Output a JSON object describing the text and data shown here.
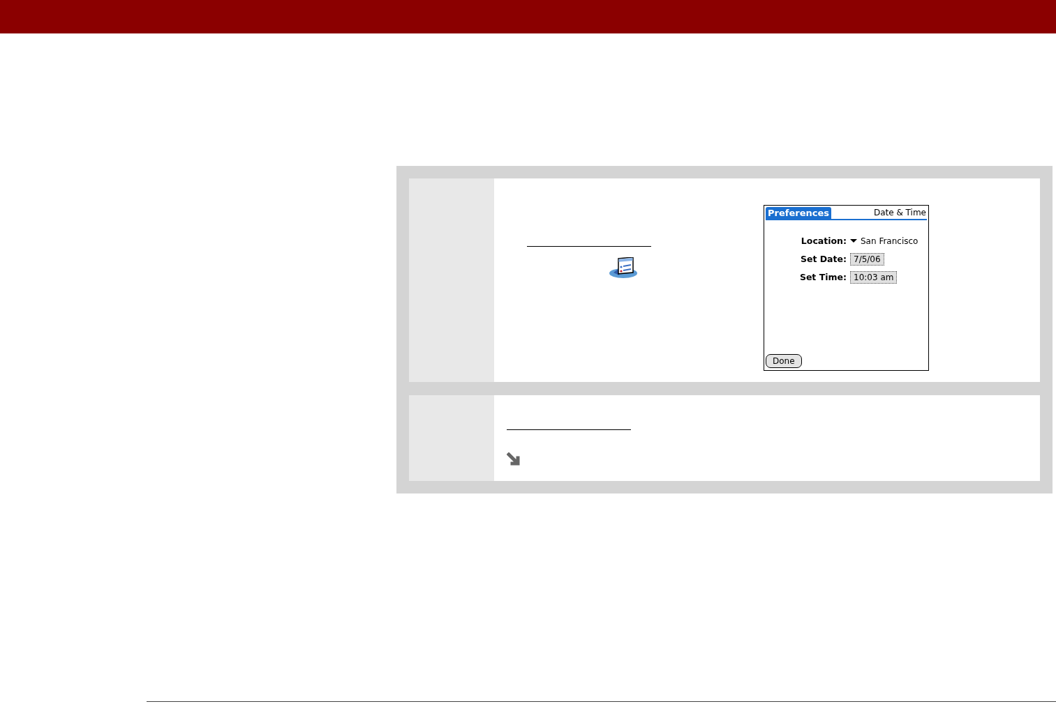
{
  "steps": [
    {
      "kind": "screen",
      "palm_screen": {
        "tab_title": "Preferences",
        "title": "Date & Time",
        "fields": [
          {
            "kind": "dropdown",
            "label": "Location:",
            "value": "San Francisco"
          },
          {
            "kind": "selector",
            "label": "Set Date:",
            "value": "7/5/06"
          },
          {
            "kind": "selector",
            "label": "Set Time:",
            "value": "10:03 am"
          }
        ],
        "button": "Done"
      }
    },
    {
      "kind": "tip"
    }
  ]
}
